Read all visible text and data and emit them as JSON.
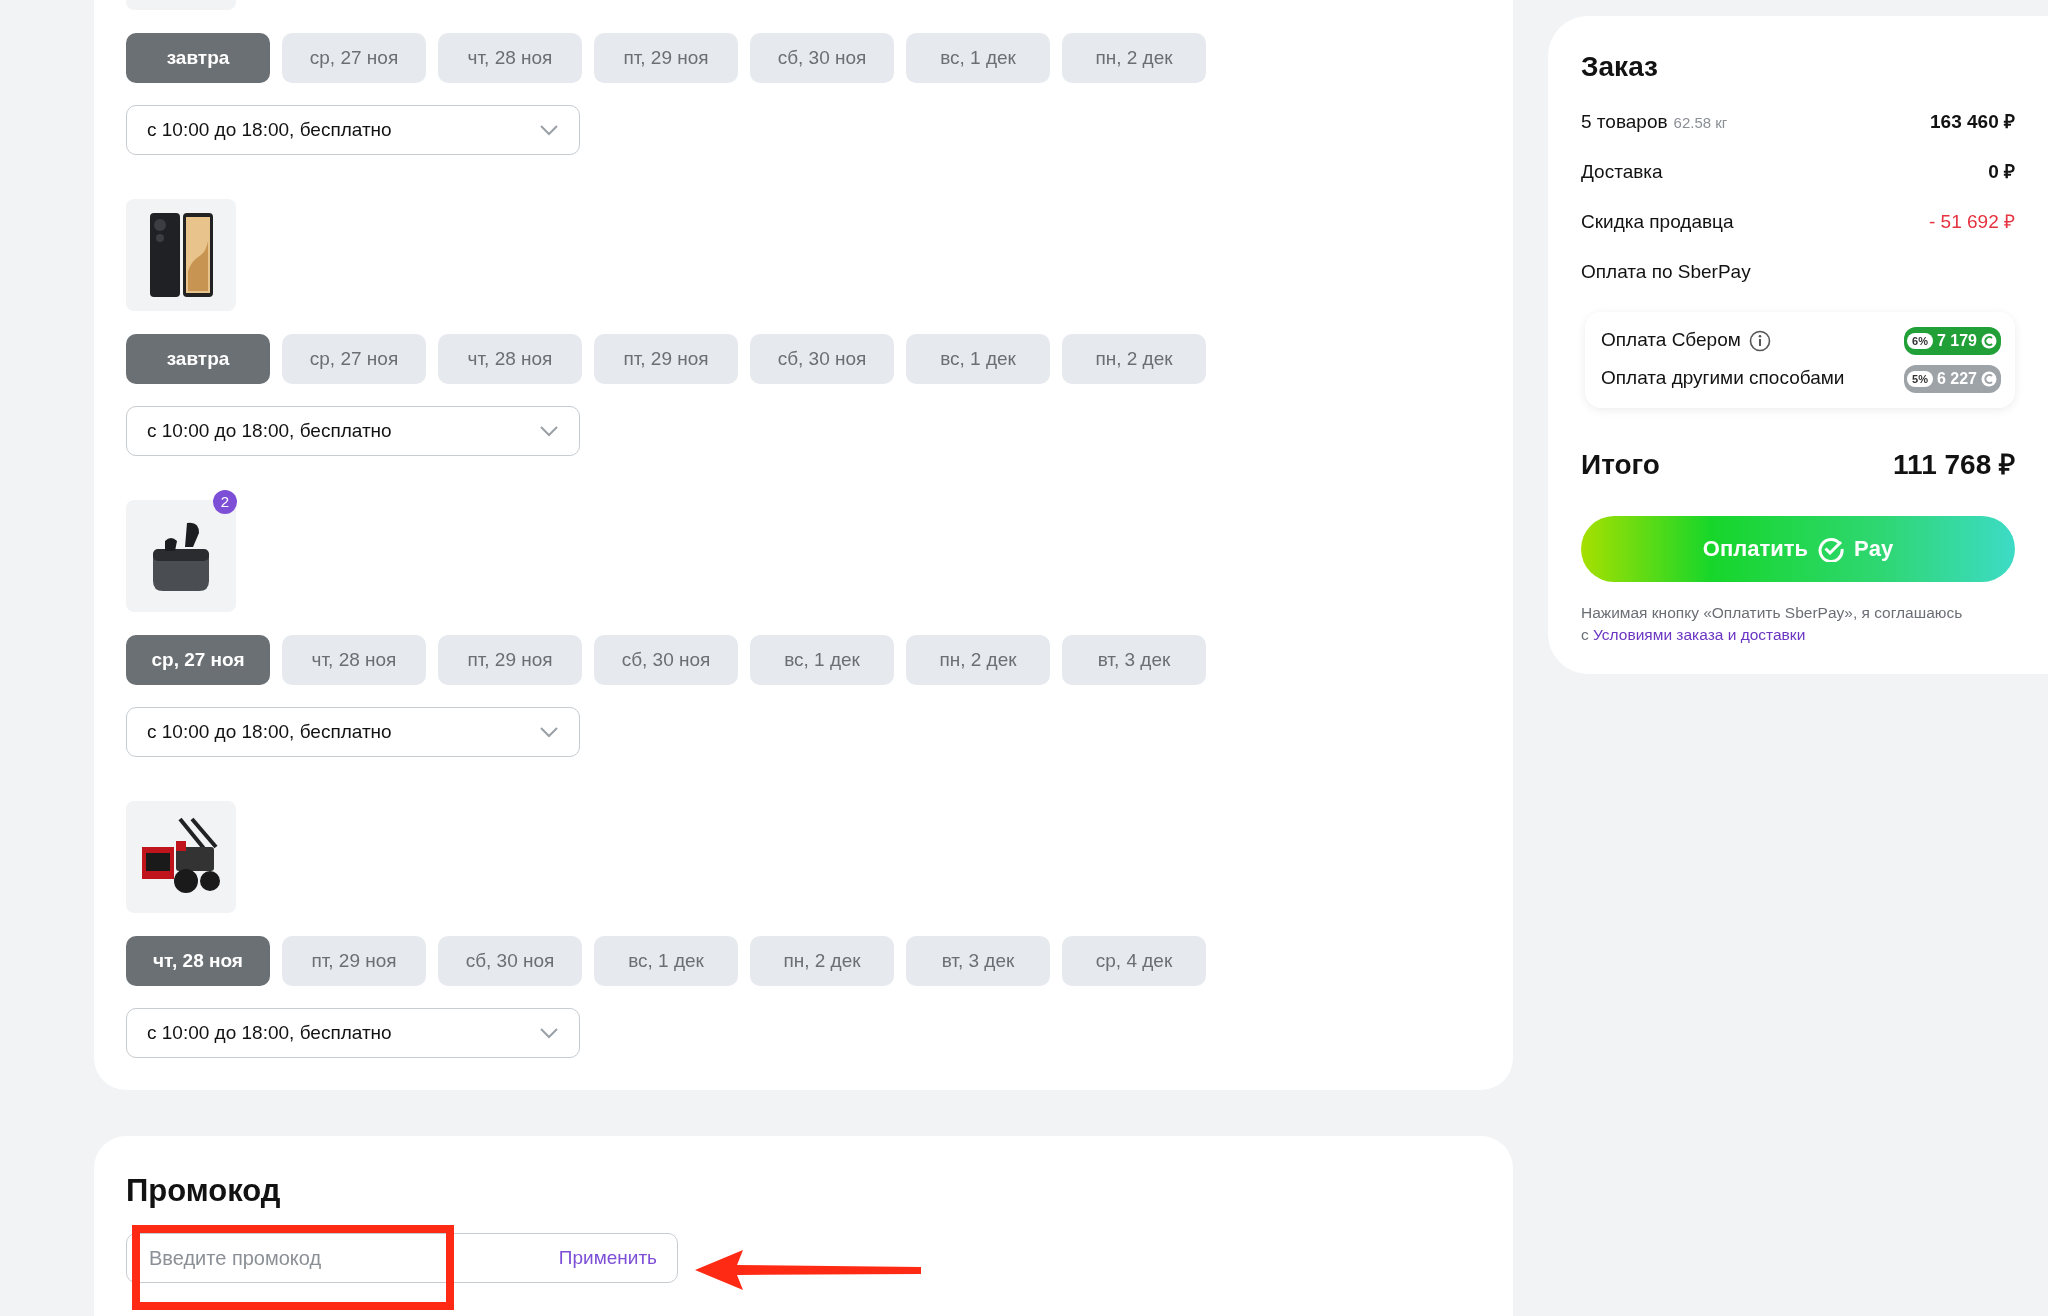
{
  "products": [
    {
      "kind": "cropped",
      "dates": [
        {
          "label": "завтра",
          "selected": true
        },
        {
          "label": "ср, 27 ноя",
          "selected": false
        },
        {
          "label": "чт, 28 ноя",
          "selected": false
        },
        {
          "label": "пт, 29 ноя",
          "selected": false
        },
        {
          "label": "сб, 30 ноя",
          "selected": false
        },
        {
          "label": "вс, 1 дек",
          "selected": false
        },
        {
          "label": "пн, 2 дек",
          "selected": false
        }
      ],
      "slot": "с 10:00 до 18:00, бесплатно"
    },
    {
      "kind": "phone",
      "dates": [
        {
          "label": "завтра",
          "selected": true
        },
        {
          "label": "ср, 27 ноя",
          "selected": false
        },
        {
          "label": "чт, 28 ноя",
          "selected": false
        },
        {
          "label": "пт, 29 ноя",
          "selected": false
        },
        {
          "label": "сб, 30 ноя",
          "selected": false
        },
        {
          "label": "вс, 1 дек",
          "selected": false
        },
        {
          "label": "пн, 2 дек",
          "selected": false
        }
      ],
      "slot": "с 10:00 до 18:00, бесплатно"
    },
    {
      "kind": "earbuds",
      "badge": "2",
      "dates": [
        {
          "label": "ср, 27 ноя",
          "selected": true
        },
        {
          "label": "чт, 28 ноя",
          "selected": false
        },
        {
          "label": "пт, 29 ноя",
          "selected": false
        },
        {
          "label": "сб, 30 ноя",
          "selected": false
        },
        {
          "label": "вс, 1 дек",
          "selected": false
        },
        {
          "label": "пн, 2 дек",
          "selected": false
        },
        {
          "label": "вт, 3 дек",
          "selected": false
        }
      ],
      "slot": "с 10:00 до 18:00, бесплатно"
    },
    {
      "kind": "snowblower",
      "dates": [
        {
          "label": "чт, 28 ноя",
          "selected": true
        },
        {
          "label": "пт, 29 ноя",
          "selected": false
        },
        {
          "label": "сб, 30 ноя",
          "selected": false
        },
        {
          "label": "вс, 1 дек",
          "selected": false
        },
        {
          "label": "пн, 2 дек",
          "selected": false
        },
        {
          "label": "вт, 3 дек",
          "selected": false
        },
        {
          "label": "ср, 4 дек",
          "selected": false
        }
      ],
      "slot": "с 10:00 до 18:00, бесплатно"
    }
  ],
  "promo": {
    "title": "Промокод",
    "placeholder": "Введите промокод",
    "button": "Применить"
  },
  "order": {
    "title": "Заказ",
    "rows": [
      {
        "label": "5 товаров",
        "note": "62.58 кг",
        "value": "163 460 ₽",
        "kind": "normal"
      },
      {
        "label": "Доставка",
        "value": "0 ₽",
        "kind": "normal"
      },
      {
        "label": "Скидка продавца",
        "value": "- 51 692 ₽",
        "kind": "discount"
      },
      {
        "label": "Оплата по SberPay",
        "kind": "normal"
      }
    ],
    "bonuses": [
      {
        "label": "Оплата Сбером",
        "info": true,
        "percent": "6%",
        "amount": "7 179",
        "color": "#21a038"
      },
      {
        "label": "Оплата другими способами",
        "info": false,
        "percent": "5%",
        "amount": "6 227",
        "color": "#9ea3a8"
      }
    ],
    "total_label": "Итого",
    "total_value": "111 768 ₽",
    "pay_button": {
      "label": "Оплатить",
      "suffix": "Pay"
    },
    "note": "Нажимая кнопку «Оплатить SberPay», я соглашаюсь с ",
    "note_link": "Условиями заказа и доставки"
  }
}
